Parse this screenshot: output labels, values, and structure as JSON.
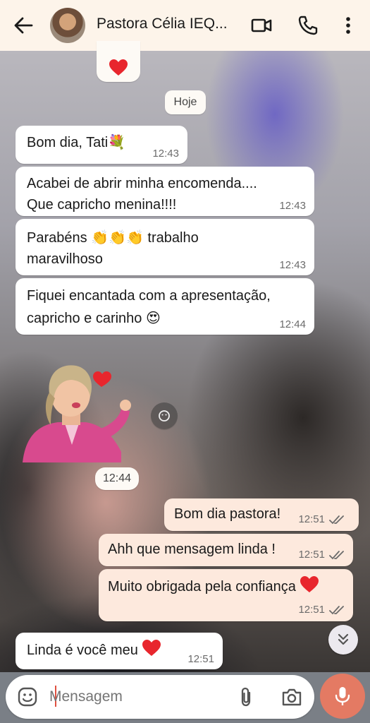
{
  "header": {
    "title": "Pastora Célia IEQ..."
  },
  "chips": {
    "date": "Hoje",
    "sticker_time": "12:44"
  },
  "messages": [
    {
      "direction": "in",
      "text": "Bom dia, Tati💐",
      "time": "12:43"
    },
    {
      "direction": "in",
      "text": "Acabei de abrir minha encomenda.... Que capricho menina!!!!",
      "time": "12:43"
    },
    {
      "direction": "in",
      "text": "Parabéns 👏👏👏 trabalho maravilhoso",
      "time": "12:43"
    },
    {
      "direction": "in",
      "text": "Fiquei encantada com a apresentação, capricho e carinho 😍",
      "time": "12:44"
    },
    {
      "direction": "out",
      "text": "Bom dia pastora!",
      "time": "12:51"
    },
    {
      "direction": "out",
      "text": "Ahh que mensagem linda !",
      "time": "12:51"
    },
    {
      "direction": "out",
      "text": "Muito obrigada pela confiança",
      "time": "12:51"
    },
    {
      "direction": "in",
      "text": "Linda é você meu",
      "time": "12:51"
    }
  ],
  "input": {
    "placeholder": "Mensagem"
  },
  "icons": {
    "back": "arrow-left-icon",
    "video": "video-call-icon",
    "phone": "phone-icon",
    "menu": "more-vertical-icon",
    "emoji": "emoji-icon",
    "attach": "paperclip-icon",
    "camera": "camera-icon",
    "mic": "microphone-icon",
    "scroll": "double-chevron-down-icon"
  },
  "colors": {
    "header_bg": "#fdf4ea",
    "incoming_bubble": "#ffffff",
    "outgoing_bubble": "#fde9dd",
    "mic_button": "#e47a63",
    "heart": "#e8262d"
  }
}
